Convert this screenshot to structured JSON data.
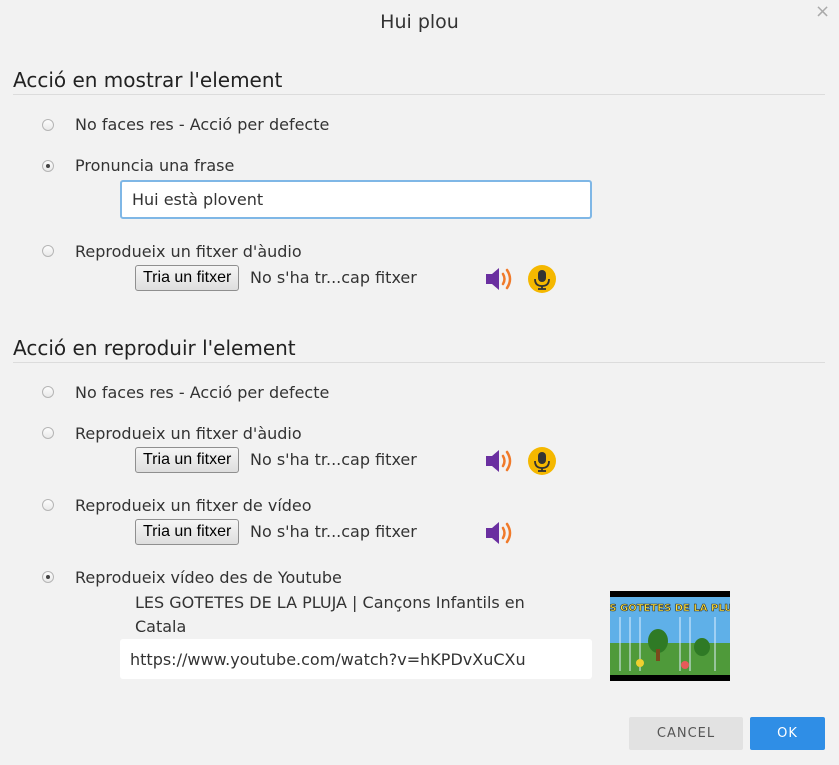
{
  "dialog": {
    "title": "Hui plou",
    "close_glyph": "×"
  },
  "section_show": {
    "title": "Acció en mostrar l'element",
    "options": [
      {
        "label": "No faces res - Acció per defecte",
        "selected": false
      },
      {
        "label": "Pronuncia una frase",
        "selected": true
      },
      {
        "label": "Reprodueix un fitxer d'àudio",
        "selected": false
      }
    ],
    "phrase_value": "Hui està plovent",
    "audio": {
      "button_label": "Tria un fitxer",
      "status": "No s'ha tr...cap fitxer"
    }
  },
  "section_play": {
    "title": "Acció en reproduir l'element",
    "options": [
      {
        "label": "No faces res - Acció per defecte",
        "selected": false
      },
      {
        "label": "Reprodueix un fitxer d'àudio",
        "selected": false
      },
      {
        "label": "Reprodueix un fitxer de vídeo",
        "selected": false
      },
      {
        "label": "Reprodueix vídeo des de Youtube",
        "selected": true
      }
    ],
    "audio": {
      "button_label": "Tria un fitxer",
      "status": "No s'ha tr...cap fitxer"
    },
    "video": {
      "button_label": "Tria un fitxer",
      "status": "No s'ha tr...cap fitxer"
    },
    "youtube": {
      "video_title": "LES GOTETES DE LA PLUJA | Cançons Infantils en Catala",
      "url": "https://www.youtube.com/watch?v=hKPDvXuCXu",
      "thumbnail_text": "LES GOTETES DE LA PLUJA"
    }
  },
  "footer": {
    "cancel_label": "CANCEL",
    "ok_label": "OK"
  },
  "icons": {
    "speaker": "speaker-icon",
    "microphone": "microphone-icon",
    "close": "close-icon"
  },
  "colors": {
    "accent": "#2f8ee6",
    "speaker_purple": "#6a2fa0",
    "speaker_waves": "#f07a2a",
    "mic_yellow": "#f5b800",
    "input_focus_border": "#7fb7e6"
  }
}
